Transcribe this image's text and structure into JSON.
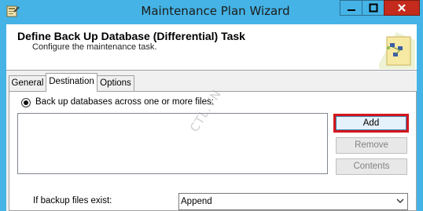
{
  "window": {
    "title": "Maintenance Plan Wizard",
    "colors": {
      "frame": "#45b3e5",
      "close": "#c42b1c",
      "highlight": "#d4161c"
    }
  },
  "header": {
    "title": "Define Back Up Database (Differential) Task",
    "subtitle": "Configure the maintenance task."
  },
  "tabs": [
    {
      "label": "General",
      "active": false
    },
    {
      "label": "Destination",
      "active": true
    },
    {
      "label": "Options",
      "active": false
    }
  ],
  "destination": {
    "radio_label": "Back up databases across one or more files:",
    "radio_selected": true,
    "files": [],
    "buttons": {
      "add": "Add",
      "remove": "Remove",
      "contents": "Contents"
    },
    "if_exists_label": "If backup files exist:",
    "if_exists_value": "Append"
  },
  "watermark": "CTL.VN",
  "icons": [
    "app-icon",
    "minimize-icon",
    "maximize-icon",
    "close-icon",
    "wizard-header-icon",
    "chevron-down-icon"
  ]
}
